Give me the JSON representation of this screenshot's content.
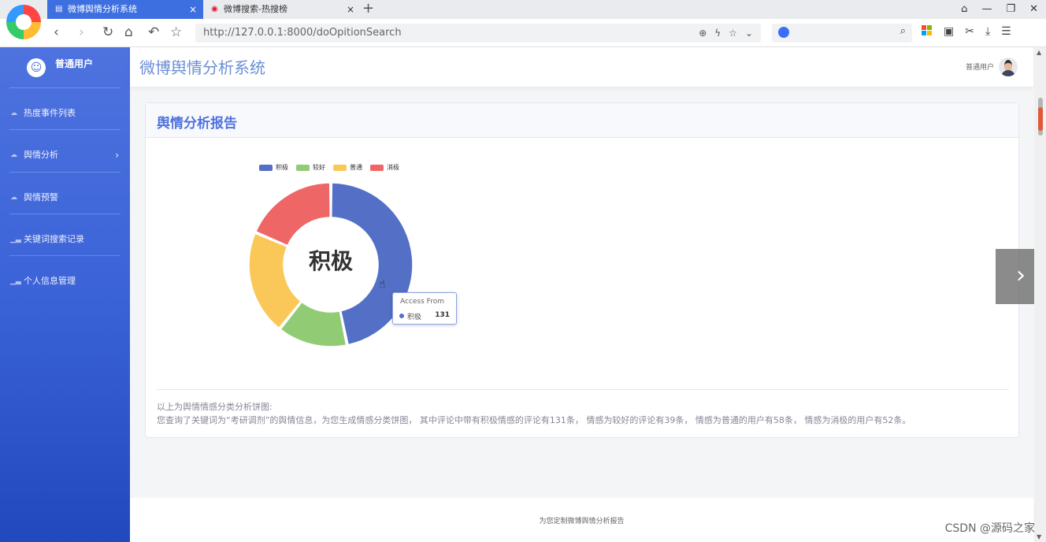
{
  "browser": {
    "tabs": [
      {
        "label": "微博舆情分析系统",
        "active": true,
        "close": "×"
      },
      {
        "label": "微博搜索-热搜榜",
        "active": false,
        "close": "×"
      }
    ],
    "new_tab": "+",
    "url": "http://127.0.0.1:8000/doOpitionSearch",
    "window_buttons": [
      "⌂",
      "—",
      "❐",
      "✕"
    ],
    "nav": {
      "back": "‹",
      "forward": "›",
      "reload": "↻",
      "home": "⌂",
      "undo": "↶",
      "bookmark": "☆"
    }
  },
  "sidebar": {
    "brand": "普通用户",
    "items": [
      {
        "label": "热度事件列表",
        "icon": "cloud-icon"
      },
      {
        "label": "舆情分析",
        "icon": "cloud-icon",
        "has_submenu": true
      },
      {
        "label": "舆情预警",
        "icon": "cloud-icon"
      },
      {
        "label": "关键词搜索记录",
        "icon": "chart-icon"
      },
      {
        "label": "个人信息管理",
        "icon": "chart-icon"
      }
    ]
  },
  "header": {
    "title": "微博舆情分析系统",
    "user": "普通用户"
  },
  "card": {
    "title": "舆情分析报告",
    "summary_title": "以上为舆情情感分类分析饼图:",
    "summary_text": "您查询了关键词为“考研调剂”的舆情信息，为您生成情感分类饼图， 其中评论中带有积极情感的评论有131条， 情感为较好的评论有39条， 情感为普通的用户有58条， 情感为消极的用户有52条。"
  },
  "chart_data": {
    "type": "pie",
    "donut": true,
    "center_label": "积极",
    "legend_position": "top-left",
    "categories": [
      "积极",
      "较好",
      "普通",
      "消极"
    ],
    "values": [
      131,
      39,
      58,
      52
    ],
    "colors": [
      "#5470c6",
      "#91cc75",
      "#fac858",
      "#ee6666"
    ],
    "tooltip": {
      "title": "Access From",
      "name": "积极",
      "value": "131"
    }
  },
  "footer": {
    "text": "为您定制微博舆情分析报告"
  },
  "watermark": "CSDN @源码之家",
  "carousel": {
    "next": "›"
  }
}
